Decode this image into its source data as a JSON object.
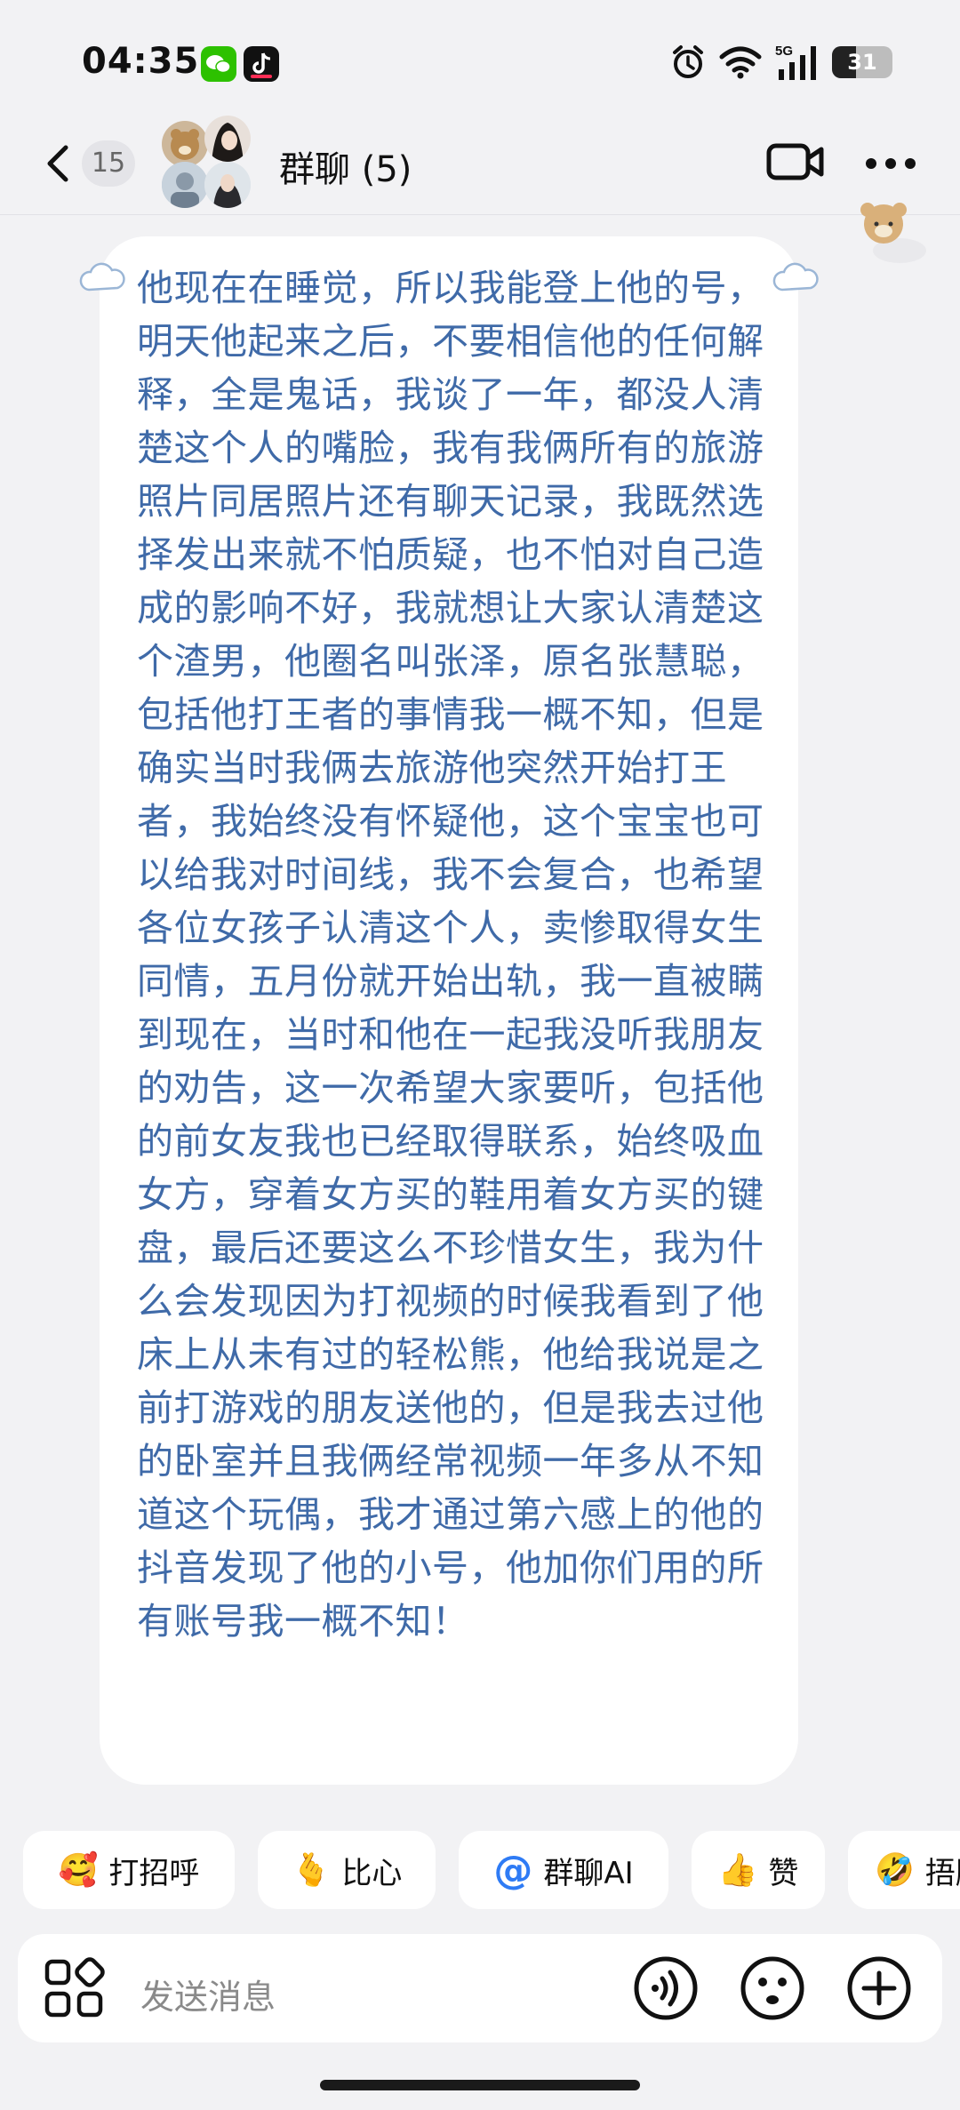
{
  "status_bar": {
    "time": "04:35",
    "apps": [
      "wechat-icon",
      "douyin-icon"
    ],
    "indicators": [
      "alarm-icon",
      "wifi-icon",
      "5g-signal-icon"
    ],
    "network": "5G",
    "battery": "31"
  },
  "header": {
    "back_count": "15",
    "title": "群聊 (5)",
    "icons": [
      "chevron-left-icon",
      "video-call-icon",
      "more-icon"
    ]
  },
  "message": {
    "text": "他现在在睡觉，所以我能登上他的号，明天他起来之后，不要相信他的任何解释，全是鬼话，我谈了一年，都没人清楚这个人的嘴脸，我有我俩所有的旅游照片同居照片还有聊天记录，我既然选择发出来就不怕质疑，也不怕对自己造成的影响不好，我就想让大家认清楚这个渣男，他圈名叫张泽，原名张慧聪，包括他打王者的事情我一概不知，但是确实当时我俩去旅游他突然开始打王者，我始终没有怀疑他，这个宝宝也可以给我对时间线，我不会复合，也希望各位女孩子认清这个人，卖惨取得女生同情，五月份就开始出轨，我一直被瞒到现在，当时和他在一起我没听我朋友的劝告，这一次希望大家要听，包括他的前女友我也已经取得联系，始终吸血女方，穿着女方买的鞋用着女方买的键盘，最后还要这么不珍惜女生，我为什么会发现因为打视频的时候我看到了他床上从未有过的轻松熊，他给我说是之前打游戏的朋友送他的，但是我去过他的卧室并且我俩经常视频一年多从不知道这个玩偶，我才通过第六感上的他的抖音发现了他的小号，他加你们用的所有账号我一概不知！",
    "text_color": "#3f6aa8"
  },
  "quick_replies": [
    {
      "icon": "🥰",
      "label": "打招呼"
    },
    {
      "icon": "🫰",
      "label": "比心"
    },
    {
      "icon": "@",
      "label": "群聊AI"
    },
    {
      "icon": "👍",
      "label": "赞"
    },
    {
      "icon": "🤣",
      "label": "捂脸"
    }
  ],
  "input": {
    "placeholder": "发送消息",
    "icons": [
      "apps-grid-icon",
      "voice-icon",
      "emoji-icon",
      "plus-icon"
    ]
  }
}
